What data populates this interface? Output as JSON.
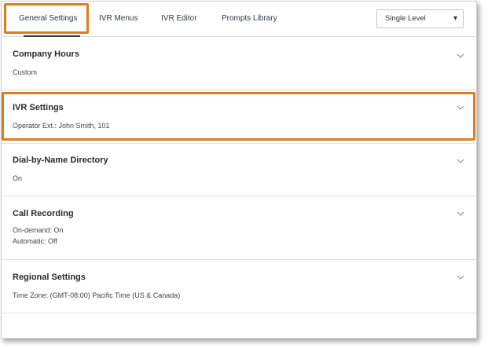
{
  "tabs": [
    {
      "label": "General Settings"
    },
    {
      "label": "IVR Menus"
    },
    {
      "label": "IVR Editor"
    },
    {
      "label": "Prompts Library"
    }
  ],
  "level_select": {
    "value": "Single Level",
    "caret": "▾"
  },
  "sections": [
    {
      "title": "Company Hours",
      "details": [
        "Custom"
      ]
    },
    {
      "title": "IVR Settings",
      "details": [
        "Operator Ext.: John Smith, 101"
      ]
    },
    {
      "title": "Dial-by-Name Directory",
      "details": [
        "On"
      ]
    },
    {
      "title": "Call Recording",
      "details": [
        "On-demand: On",
        "Automatic: Off"
      ]
    },
    {
      "title": "Regional Settings",
      "details": [
        "Time Zone: (GMT-08:00) Pacific Time (US & Canada)"
      ]
    }
  ],
  "colors": {
    "highlight": "#e07b20",
    "divider": "#dedede",
    "text": "#333333"
  }
}
